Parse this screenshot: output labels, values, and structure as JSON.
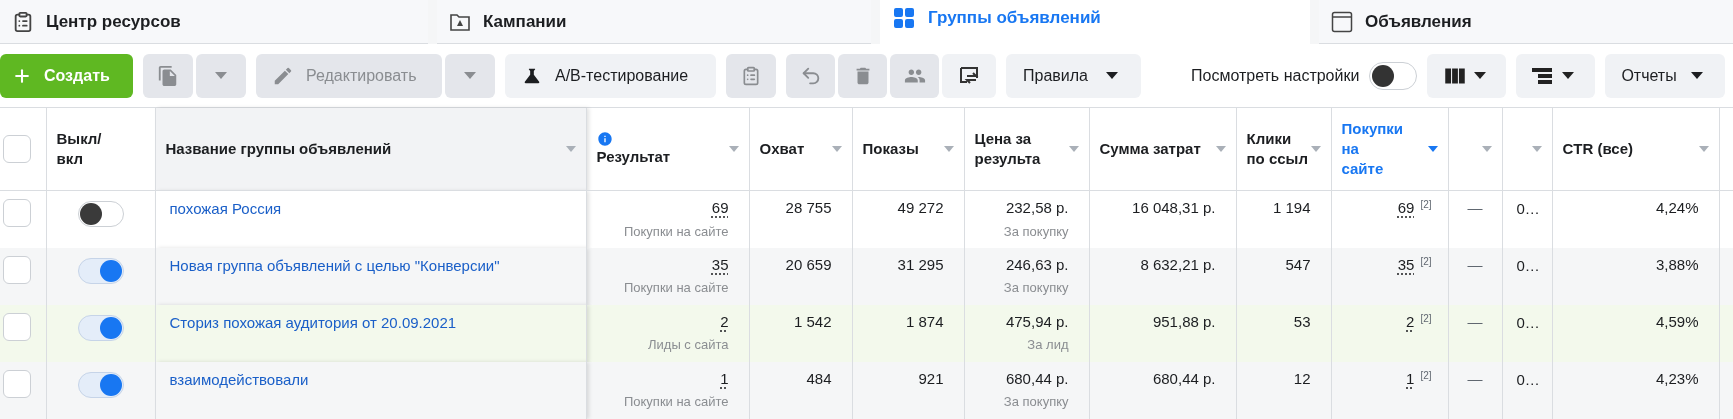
{
  "tabs": [
    {
      "label": "Центр ресурсов",
      "selected": false
    },
    {
      "label": "Кампании",
      "selected": false
    },
    {
      "label": "Группы объявлений",
      "selected": true
    },
    {
      "label": "Объявления",
      "selected": false
    }
  ],
  "toolbar": {
    "create": {
      "label": "Создать"
    },
    "duplicate": {
      "disabled": true
    },
    "edit": {
      "label": "Редактировать",
      "disabled": true
    },
    "ab_test": {
      "label": "A/B-тестирование"
    },
    "draft": {
      "disabled": true
    },
    "undo": {
      "disabled": true
    },
    "delete": {
      "disabled": true
    },
    "audience": {
      "disabled": true
    },
    "swap": {
      "disabled": false
    },
    "rules": {
      "label": "Правила"
    },
    "view_settings": {
      "label": "Посмотреть настройки",
      "on": false
    },
    "reports": {
      "label": "Отчеты"
    }
  },
  "table": {
    "select_all": {
      "checked": false
    },
    "columns": [
      {
        "label": "Выкл/ вкл",
        "highlighted": false
      },
      {
        "label": "Название группы объявлений",
        "highlighted": false
      },
      {
        "label": "Результат",
        "highlighted": false
      },
      {
        "label": "Охват",
        "highlighted": false
      },
      {
        "label": "Показы",
        "highlighted": false
      },
      {
        "label": "Цена за результа",
        "highlighted": false
      },
      {
        "label": "Сумма затрат",
        "highlighted": false
      },
      {
        "label": "Клики по ссыл",
        "highlighted": false
      },
      {
        "label": "Покупки на сайте",
        "highlighted": true
      },
      {
        "highlighted": false
      },
      {
        "highlighted": false
      },
      {
        "label": "CTR (все)",
        "highlighted": false
      }
    ],
    "rows": [
      {
        "checked": false,
        "on": false,
        "highlighted": false,
        "name": "похожая Россия",
        "result": "69",
        "result_type": "Покупки на сайте",
        "reach": "28 755",
        "impressions": "49 272",
        "cost": "232,58 р.",
        "cost_type": "За покупку",
        "spent": "16 048,31 р.",
        "clicks": "1 194",
        "purchases": "69",
        "purchases_note": "[2]",
        "column_10": "—",
        "column_11": "0…",
        "ctr": "4,24%"
      },
      {
        "checked": false,
        "on": true,
        "highlighted": false,
        "name": "Новая группа объявлений с целью \"Конверсии\"",
        "result": "35",
        "result_type": "Покупки на сайте",
        "reach": "20 659",
        "impressions": "31 295",
        "cost": "246,63 р.",
        "cost_type": "За покупку",
        "spent": "8 632,21 р.",
        "clicks": "547",
        "purchases": "35",
        "purchases_note": "[2]",
        "column_10": "—",
        "column_11": "0…",
        "ctr": "3,88%"
      },
      {
        "checked": false,
        "on": true,
        "highlighted": true,
        "name": "Сториз похожая аудитория от 20.09.2021",
        "result": "2",
        "result_type": "Лиды с сайта",
        "reach": "1 542",
        "impressions": "1 874",
        "cost": "475,94 р.",
        "cost_type": "За лид",
        "spent": "951,88 р.",
        "clicks": "53",
        "purchases": "2",
        "purchases_note": "[2]",
        "column_10": "—",
        "column_11": "0…",
        "ctr": "4,59%"
      },
      {
        "checked": false,
        "on": true,
        "highlighted": false,
        "name": "взаимодействовали",
        "result": "1",
        "result_type": "Покупки на сайте",
        "reach": "484",
        "impressions": "921",
        "cost": "680,44 р.",
        "cost_type": "За покупку",
        "spent": "680,44 р.",
        "clicks": "12",
        "purchases": "1",
        "purchases_note": "[2]",
        "column_10": "—",
        "column_11": "0…",
        "ctr": "4,23%"
      }
    ]
  }
}
